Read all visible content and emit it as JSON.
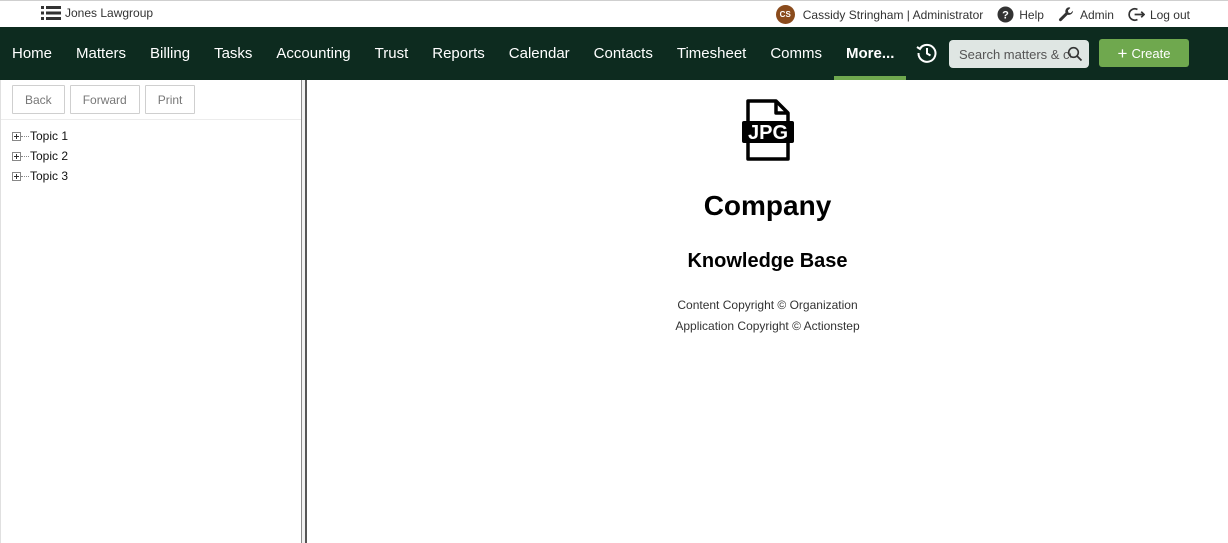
{
  "topbar": {
    "org_name": "Jones Lawgroup",
    "user_initials": "CS",
    "user_label": "Cassidy Stringham | Administrator",
    "links": [
      {
        "label": "Help",
        "icon": "help-icon"
      },
      {
        "label": "Admin",
        "icon": "wrench-icon"
      },
      {
        "label": "Log out",
        "icon": "logout-icon"
      }
    ],
    "avatar_color": "#8a4b1c"
  },
  "nav": {
    "items": [
      "Home",
      "Matters",
      "Billing",
      "Tasks",
      "Accounting",
      "Trust",
      "Reports",
      "Calendar",
      "Contacts",
      "Timesheet",
      "Comms",
      "More..."
    ],
    "active": "More...",
    "search_placeholder": "Search matters & co",
    "create_label": "Create",
    "background": "#0d2b1f",
    "accent": "#6fa84e"
  },
  "left_pane": {
    "toolbar": [
      "Back",
      "Forward",
      "Print"
    ],
    "tree": [
      "Topic 1",
      "Topic 2",
      "Topic 3"
    ]
  },
  "content": {
    "file_icon_label": "JPG",
    "title": "Company",
    "subtitle": "Knowledge Base",
    "copyright_content": "Content Copyright © Organization",
    "copyright_app": "Application Copyright © Actionstep"
  }
}
